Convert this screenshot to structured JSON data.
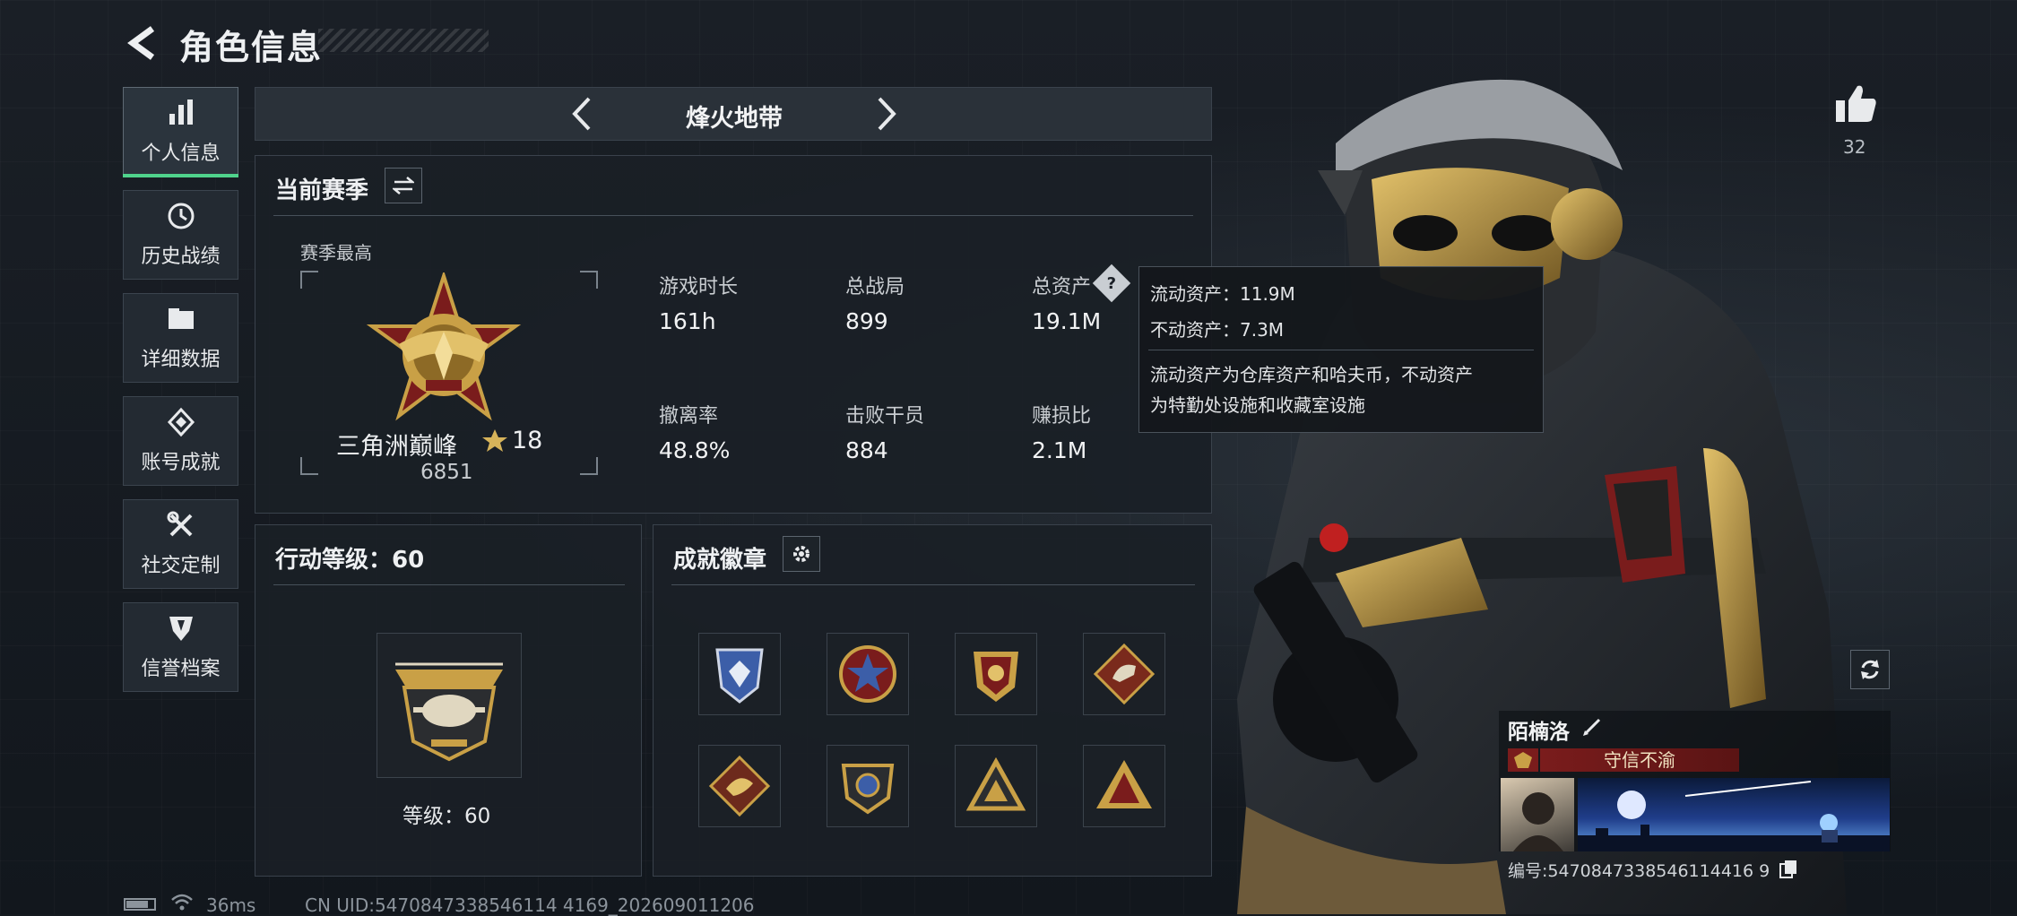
{
  "header": {
    "title": "角色信息"
  },
  "nav": [
    {
      "label": "个人信息",
      "icon": "bar-chart-icon",
      "active": true
    },
    {
      "label": "历史战绩",
      "icon": "history-icon"
    },
    {
      "label": "详细数据",
      "icon": "folder-icon"
    },
    {
      "label": "账号成就",
      "icon": "achievement-icon"
    },
    {
      "label": "社交定制",
      "icon": "tools-icon"
    },
    {
      "label": "信誉档案",
      "icon": "shield-icon"
    }
  ],
  "mode_tab": {
    "title": "烽火地带"
  },
  "season": {
    "title": "当前赛季",
    "best_label": "赛季最高",
    "rank_name": "三角洲巅峰",
    "rank_stars": "18",
    "rank_score": "6851",
    "stats": [
      {
        "label": "游戏时长",
        "value": "161h"
      },
      {
        "label": "总战局",
        "value": "899"
      },
      {
        "label": "总资产",
        "value": "19.1M"
      },
      {
        "label": "撤离率",
        "value": "48.8%"
      },
      {
        "label": "击败干员",
        "value": "884"
      },
      {
        "label": "赚损比",
        "value": "2.1M"
      }
    ]
  },
  "tooltip": {
    "liquid": "流动资产：11.9M",
    "fixed": "不动资产：7.3M",
    "desc1": "流动资产为仓库资产和哈夫币，不动资产",
    "desc2": "为特勤处设施和收藏室设施"
  },
  "level": {
    "title": "行动等级：60",
    "label": "等级：60"
  },
  "badges": {
    "title": "成就徽章",
    "count": 8
  },
  "profile": {
    "likes": "32",
    "name": "陌楠洛",
    "honor": "守信不渝",
    "id_text": "编号:5470847338546114416 9"
  },
  "footer": {
    "ping": "36ms",
    "uid": "CN UID:5470847338546114 4169_202609011206"
  },
  "colors": {
    "accent": "#4fd38c",
    "gold": "#c9a046",
    "honor_red": "#7a1c1c"
  }
}
